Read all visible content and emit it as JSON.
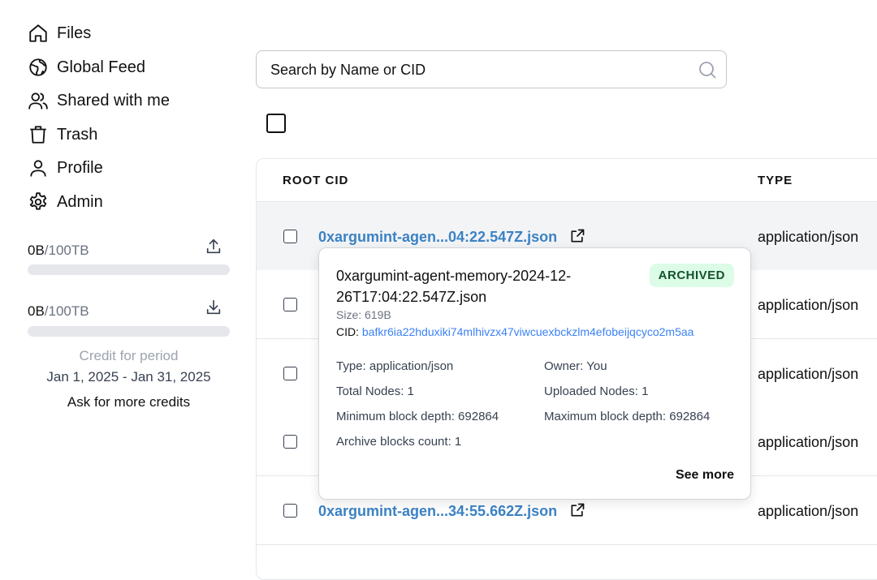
{
  "sidebar": {
    "items": [
      {
        "label": "Files",
        "icon": "home-icon"
      },
      {
        "label": "Global Feed",
        "icon": "globe-icon"
      },
      {
        "label": "Shared with me",
        "icon": "users-icon"
      },
      {
        "label": "Trash",
        "icon": "trash-icon"
      },
      {
        "label": "Profile",
        "icon": "user-icon"
      },
      {
        "label": "Admin",
        "icon": "gear-icon"
      }
    ],
    "upload_quota": {
      "used": "0B",
      "total": "/100TB",
      "fraction": 0
    },
    "download_quota": {
      "used": "0B",
      "total": "/100TB",
      "fraction": 0
    },
    "credit": {
      "title": "Credit for period",
      "range": "Jan 1, 2025 - Jan 31, 2025",
      "more": "Ask for more credits"
    }
  },
  "search": {
    "placeholder": "Search by Name or CID",
    "value": ""
  },
  "table": {
    "headers": {
      "root_cid": "ROOT CID",
      "type": "TYPE"
    },
    "rows": [
      {
        "name": "0xargumint-agen...04:22.547Z.json",
        "type": "application/json"
      },
      {
        "name": "",
        "type": "application/json"
      },
      {
        "name": "",
        "type": "application/json"
      },
      {
        "name": "",
        "type": "application/json"
      },
      {
        "name": "0xargumint-agen...34:55.662Z.json",
        "type": "application/json"
      }
    ]
  },
  "popover": {
    "name": "0xargumint-agent-memory-2024-12-26T17:04:22.547Z.json",
    "badge": "ARCHIVED",
    "size": "Size: 619B",
    "cid_label": "CID: ",
    "cid": "bafkr6ia22hduxiki74mlhivzx47viwcuexbckzlm4efobeijqcyco2m5aa",
    "type": "Type: application/json",
    "owner": "Owner: You",
    "total_nodes": "Total Nodes: 1",
    "uploaded_nodes": "Uploaded Nodes: 1",
    "min_depth": "Minimum block depth: 692864",
    "max_depth": "Maximum block depth: 692864",
    "archive_blocks": "Archive blocks count: 1",
    "see_more": "See more"
  },
  "colors": {
    "accent": "#3b82c4",
    "badge_bg": "#dcfce7",
    "badge_text": "#14532d"
  }
}
